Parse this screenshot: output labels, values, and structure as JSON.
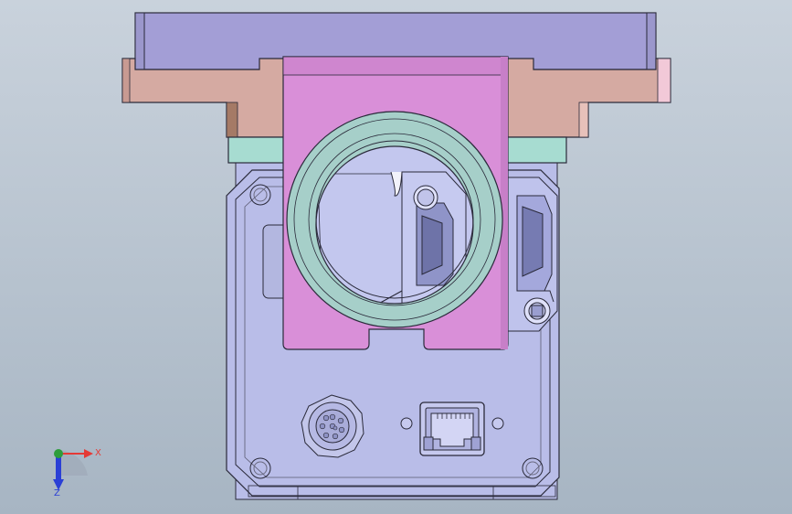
{
  "viewport": {
    "background_top": "#c9d2dc",
    "background_bottom": "#a7b5c3"
  },
  "triad": {
    "x_label": "X",
    "z_label": "Z",
    "x_color": "#e53935",
    "y_color": "#2e9d3b",
    "z_color": "#2a3fd6"
  },
  "parts": {
    "top_plate_color": "#a39ed6",
    "flange_color": "#d5aaa2",
    "collar_color": "#a7dcd1",
    "bracket_color": "#d98fd8",
    "housing_color": "#b9bde8",
    "ring_color": "#a6cfc9",
    "outline_color": "#2a2a3a"
  }
}
